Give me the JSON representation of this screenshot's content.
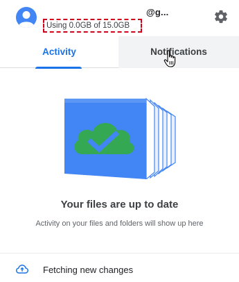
{
  "header": {
    "account_email": "@g...",
    "storage_text": "Using 0.0GB of 15.0GB"
  },
  "tabs": [
    {
      "label": "Activity",
      "selected": true
    },
    {
      "label": "Notifications",
      "selected": false
    }
  ],
  "empty_state": {
    "title": "Your files are up to date",
    "subtitle": "Activity on your files and folders will show up here"
  },
  "status": {
    "text": "Fetching new changes",
    "icon": "cloud-sync-icon"
  },
  "colors": {
    "accent": "#1a73e8",
    "highlight_border": "#d0021b",
    "illustration_folder": "#4285f4",
    "illustration_cloud": "#34a853"
  },
  "icons": {
    "avatar": "person-avatar-icon",
    "settings": "gear-icon",
    "illustration": "folder-cloud-check-illustration"
  }
}
